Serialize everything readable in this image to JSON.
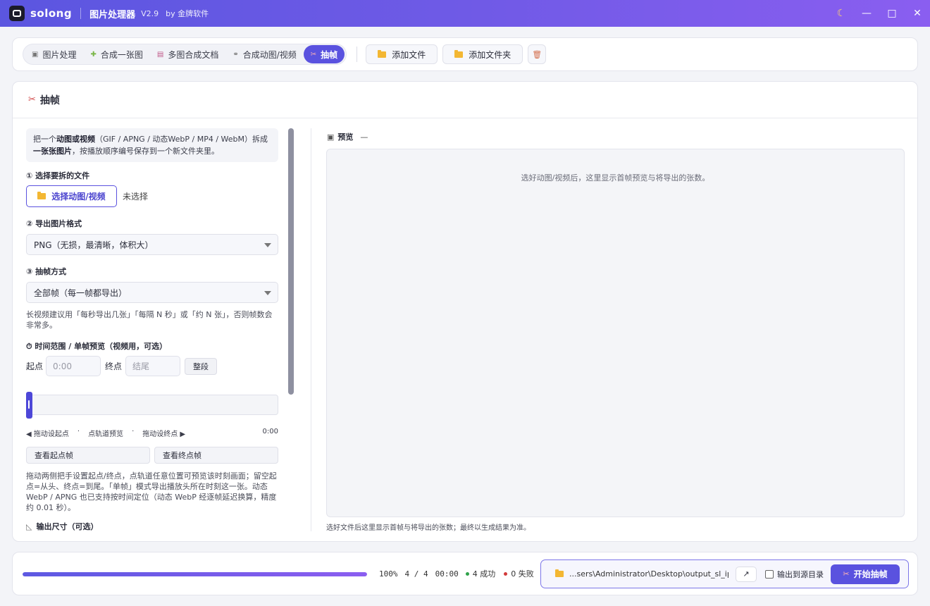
{
  "titlebar": {
    "brand": "solong",
    "app_name": "图片处理器",
    "version": "V2.9",
    "byline": "by 金牌软件",
    "controls": [
      "☾",
      "◯",
      "□",
      "✕"
    ]
  },
  "nav": {
    "tabs": [
      {
        "label": "图片处理",
        "icon": "image-icon"
      },
      {
        "label": "合成一张图",
        "icon": "puzzle-icon"
      },
      {
        "label": "多图合成文档",
        "icon": "document-icon"
      },
      {
        "label": "合成动图/视频",
        "icon": "link-icon"
      },
      {
        "label": "抽帧",
        "icon": "scissors-icon",
        "active": true
      }
    ],
    "add_file": "添加文件",
    "add_folder": "添加文件夹"
  },
  "main": {
    "title": "抽帧",
    "info_prefix": "把一个",
    "info_bold1": "动图或视频",
    "info_mid": "（GIF / APNG / 动态WebP / MP4 / WebM）拆成",
    "info_bold2": "一张张图片",
    "info_suffix": "，按播放顺序编号保存到一个新文件夹里。",
    "step1": "① 选择要拆的文件",
    "pick_button": "选择动图/视频",
    "pick_status": "未选择",
    "step2": "② 导出图片格式",
    "format_value": "PNG（无损，最清晰，体积大）",
    "step3": "③ 抽帧方式",
    "mode_value": "全部帧（每一帧都导出）",
    "mode_hint": "长视频建议用「每秒导出几张」「每隔 N 秒」或「约 N 张」，否则帧数会非常多。",
    "time_section": "⏱ 时间范围 / 单帧预览（视频用，可选）",
    "start_label": "起点",
    "start_placeholder": "0:00",
    "end_label": "终点",
    "end_placeholder": "结尾",
    "whole_button": "整段",
    "legend_left": "◀ 拖动设起点",
    "legend_mid": "点轨道预览",
    "legend_right": "拖动设终点 ▶",
    "legend_time": "0:00",
    "view_start": "查看起点帧",
    "view_end": "查看终点帧",
    "time_hint": "拖动两侧把手设置起点/终点，点轨道任意位置可预览该时刻画面；留空起点=从头、终点=到尾。「单帧」模式导出播放头所在时刻这一张。动态 WebP / APNG 也已支持按时间定位（动态 WebP 经逐帧延迟换算，精度约 0.01 秒）。",
    "output_size": "输出尺寸（可选）",
    "preview_label": "预览",
    "preview_dash": "—",
    "preview_message": "选好动图/视频后，这里显示首帧预览与将导出的张数。",
    "preview_footer": "选好文件后这里显示首帧与将导出的张数；最终以生成结果为准。"
  },
  "bottom": {
    "progress": 1.0,
    "percent": "100%",
    "count": "4 / 4",
    "elapsed": "00:00",
    "success": "4 成功",
    "fail": "0 失败",
    "success_color": "#2fa24a",
    "fail_color": "#d23b3b",
    "output_path": "...sers\\Administrator\\Desktop\\output_sl_ip",
    "open_icon": "↗",
    "to_source": "输出到源目录",
    "start_button": "开始抽帧"
  }
}
